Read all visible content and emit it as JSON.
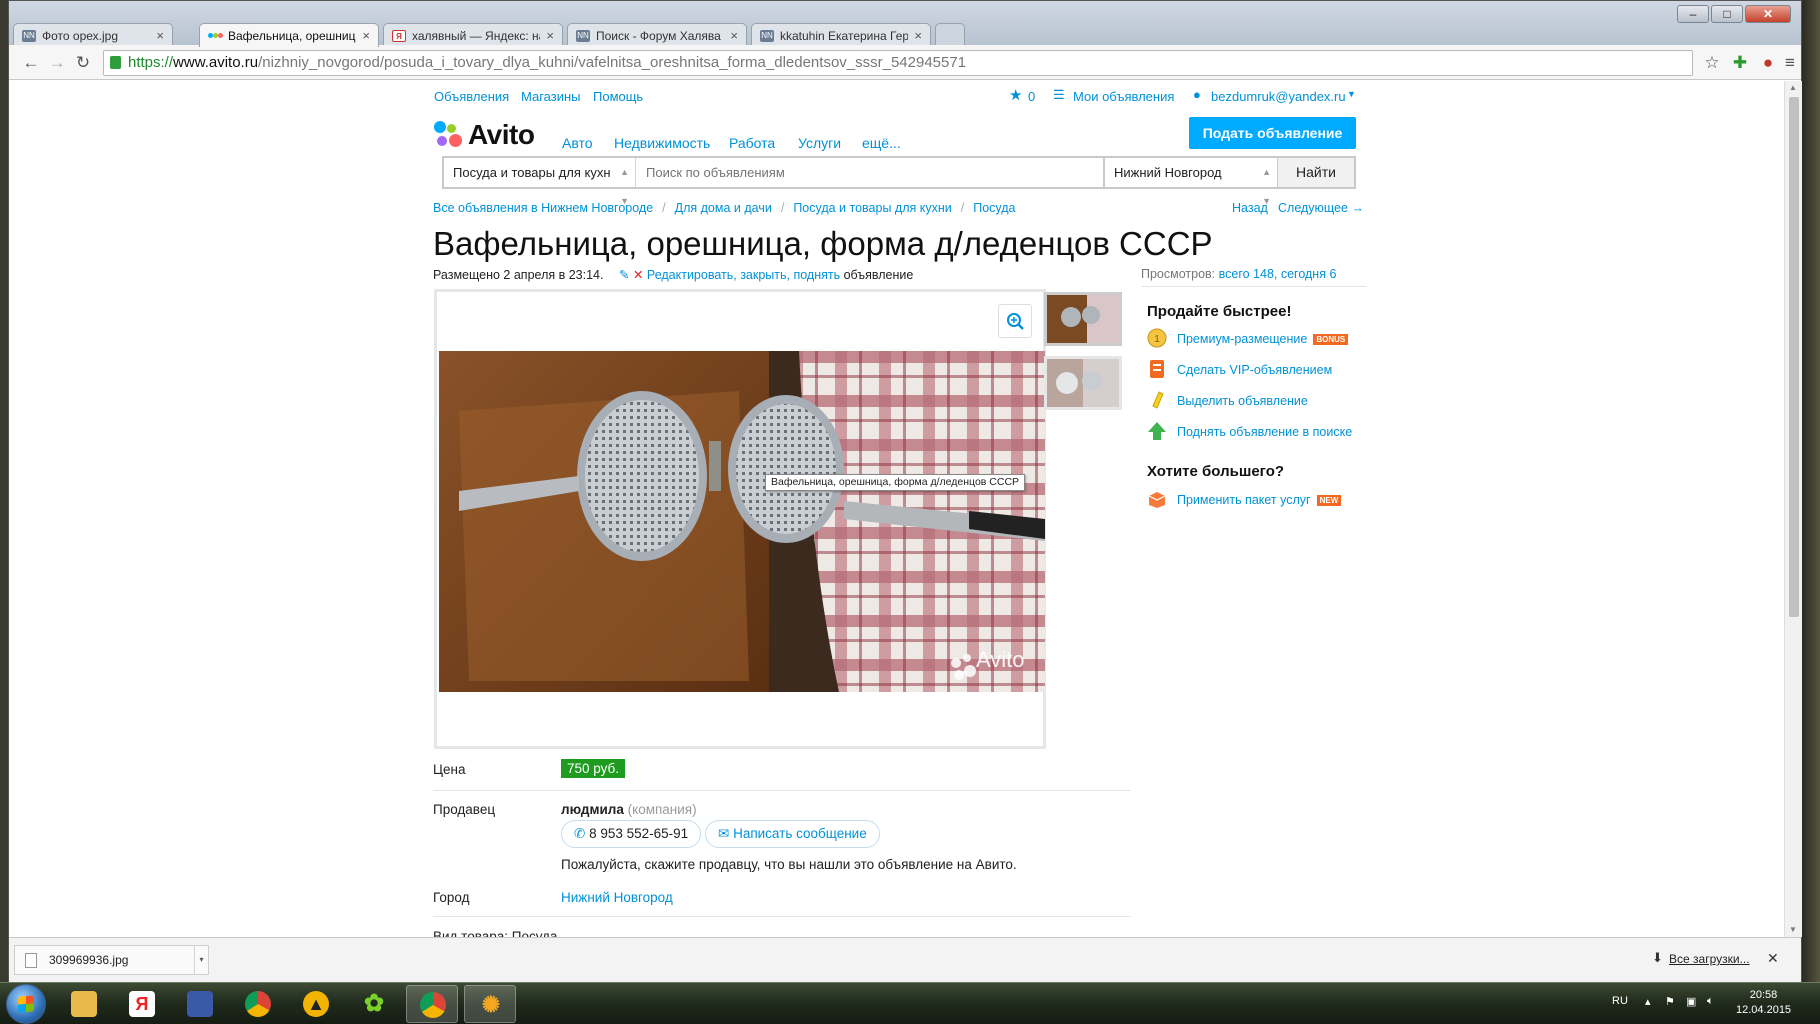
{
  "browser": {
    "tabs": [
      {
        "label": "Фото орех.jpg",
        "icon": "nn-favicon"
      },
      {
        "label": "Вафельница, орешница, ",
        "icon": "avito-favicon",
        "active": true
      },
      {
        "label": "халявный — Яндекс: наш",
        "icon": "yandex-favicon"
      },
      {
        "label": "Поиск - Форум Халява в",
        "icon": "nn-favicon"
      },
      {
        "label": "kkatuhin Екатерина Герм",
        "icon": "nn-favicon"
      }
    ],
    "url_scheme": "https://",
    "url_host": "www.avito.ru",
    "url_path": "/nizhniy_novgorod/posuda_i_tovary_dlya_kuhni/vafelnitsa_oreshnitsa_forma_dledentsov_sssr_542945571"
  },
  "site": {
    "top_links": [
      "Объявления",
      "Магазины",
      "Помощь"
    ],
    "favorites_count": "0",
    "my_ads": "Мои объявления",
    "user_email": "bezdumruk@yandex.ru",
    "logo_text": "Avito",
    "main_nav": [
      "Авто",
      "Недвижимость",
      "Работа",
      "Услуги",
      "ещё..."
    ],
    "post_button": "Подать объявление",
    "search": {
      "category": "Посуда и товары для кухн",
      "placeholder": "Поиск по объявлениям",
      "city": "Нижний Новгород",
      "button": "Найти"
    }
  },
  "breadcrumbs": [
    "Все объявления в Нижнем Новгороде",
    "Для дома и дачи",
    "Посуда и товары для кухни",
    "Посуда"
  ],
  "nav_back": "Назад",
  "nav_next": "Следующее →",
  "listing": {
    "title": "Вафельница, орешница, форма д/леденцов СССР",
    "posted": "Размещено 2 апреля в 23:14.",
    "edit_links": "Редактировать, закрыть, поднять",
    "edit_suffix": "объявление",
    "views_label": "Просмотров:",
    "views_value": "всего 148, сегодня 6",
    "photo_tooltip": "Вафельница, орешница, форма д/леденцов СССР",
    "watermark": "Avito",
    "price_label": "Цена",
    "price": "750 руб.",
    "seller_label": "Продавец",
    "seller_name": "людмила",
    "seller_type": "(компания)",
    "phone": "8 953 552-65-91",
    "message_button": "Написать сообщение",
    "seller_note": "Пожалуйста, скажите продавцу, что вы нашли это объявление на Авито.",
    "city_label": "Город",
    "city": "Нижний Новгород",
    "goods_type": "Вид товара: Посуда"
  },
  "promo": {
    "title": "Продайте быстрее!",
    "items": [
      {
        "label": "Премиум-размещение",
        "badge": "BONUS",
        "icon": "coin-icon"
      },
      {
        "label": "Сделать VIP-объявлением",
        "icon": "vip-icon"
      },
      {
        "label": "Выделить объявление",
        "icon": "highlight-icon"
      },
      {
        "label": "Поднять объявление в поиске",
        "icon": "arrow-up-icon"
      }
    ],
    "more_title": "Хотите большего?",
    "package": {
      "label": "Применить пакет услуг",
      "badge": "NEW",
      "icon": "package-icon"
    }
  },
  "downloads": {
    "file": "309969936.jpg",
    "all_link": "Все загрузки..."
  },
  "taskbar": {
    "lang": "RU",
    "time": "20:58",
    "date": "12.04.2015"
  },
  "colors": {
    "accent": "#0091d9",
    "post_button": "#00aaff",
    "price": "#1f9b1f",
    "bonus_badge": "#f26a21",
    "new_badge": "#f26a21"
  }
}
